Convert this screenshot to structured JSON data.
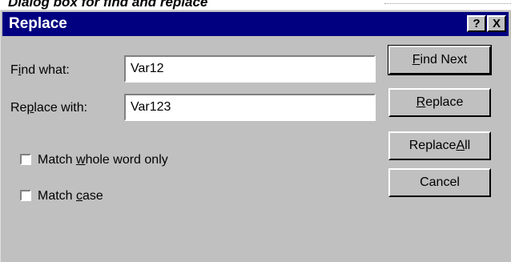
{
  "caption": "Dialog box for find and replace",
  "dialog": {
    "title": "Replace",
    "help_label": "?",
    "close_label": "X"
  },
  "form": {
    "find_label_pre": "F",
    "find_label_mn": "i",
    "find_label_post": "nd what:",
    "find_value": "Var12",
    "replace_label_pre": "Re",
    "replace_label_mn": "p",
    "replace_label_post": "lace with:",
    "replace_value": "Var123"
  },
  "options": {
    "whole_word_pre": "Match ",
    "whole_word_mn": "w",
    "whole_word_post": "hole word only",
    "whole_word_checked": false,
    "match_case_pre": "Match ",
    "match_case_mn": "c",
    "match_case_post": "ase",
    "match_case_checked": false
  },
  "buttons": {
    "find_next_mn": "F",
    "find_next_post": "ind Next",
    "replace_mn": "R",
    "replace_post": "eplace",
    "replace_all_pre": "Replace ",
    "replace_all_mn": "A",
    "replace_all_post": "ll",
    "cancel": "Cancel"
  }
}
